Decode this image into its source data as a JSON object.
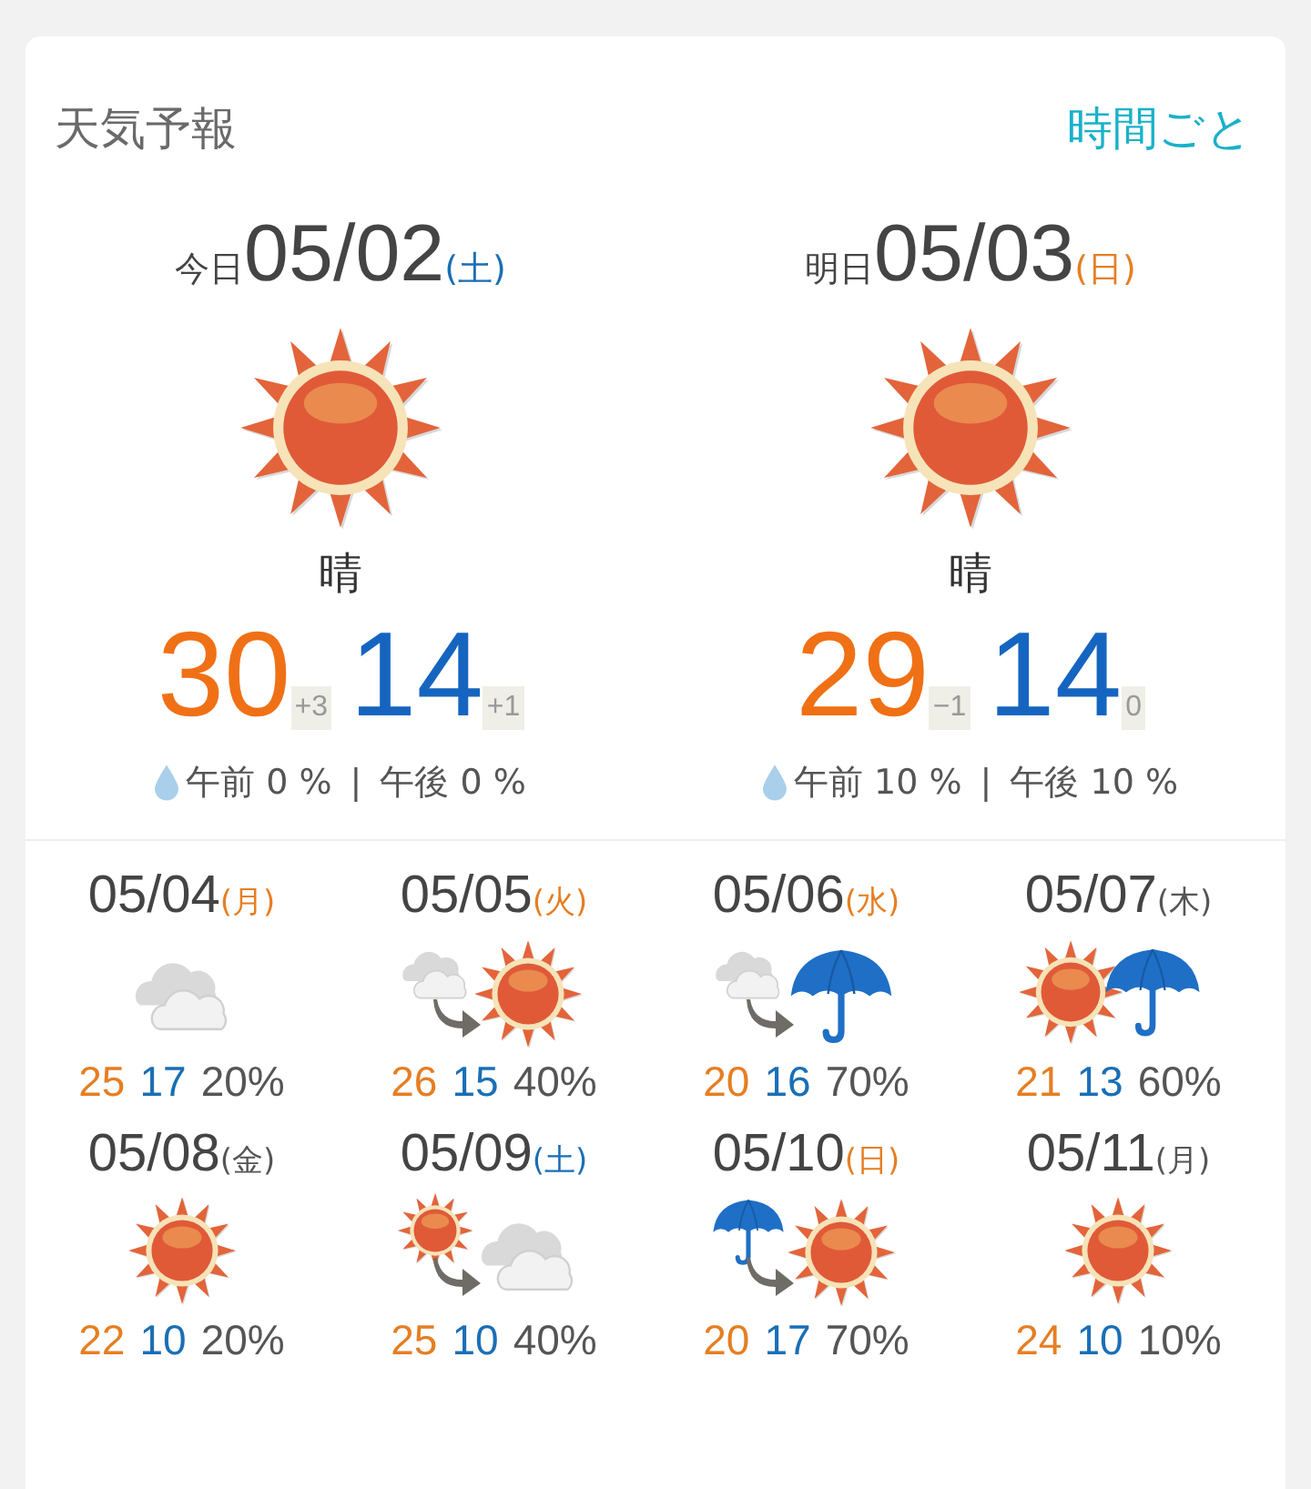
{
  "header": {
    "title": "天気予報",
    "link": "時間ごと"
  },
  "main_days": [
    {
      "label": "今日",
      "date": "05/02",
      "weekday": {
        "text": "(土)",
        "color": "#1a6fb5"
      },
      "icons": [
        {
          "kind": "sun"
        }
      ],
      "condition": "晴",
      "high": "30",
      "high_diff": "+3",
      "low": "14",
      "low_diff": "+1",
      "rain": [
        {
          "period": "午前",
          "value": "0 %"
        },
        {
          "period": "午後",
          "value": "0 %"
        }
      ],
      "separator": "|"
    },
    {
      "label": "明日",
      "date": "05/03",
      "weekday": {
        "text": "(日)",
        "color": "#e67e22"
      },
      "icons": [
        {
          "kind": "sun"
        }
      ],
      "condition": "晴",
      "high": "29",
      "high_diff": "−1",
      "low": "14",
      "low_diff": "0",
      "rain": [
        {
          "period": "午前",
          "value": "10 %"
        },
        {
          "period": "午後",
          "value": "10 %"
        }
      ],
      "separator": "|"
    }
  ],
  "forecast": [
    {
      "date": "05/04",
      "weekday": {
        "text": "(月)",
        "color": "#e67e22"
      },
      "icons": [
        {
          "kind": "cloud"
        }
      ],
      "arrow": false,
      "high": "25",
      "low": "17",
      "rain": "20%"
    },
    {
      "date": "05/05",
      "weekday": {
        "text": "(火)",
        "color": "#e67e22"
      },
      "icons": [
        {
          "kind": "cloud"
        },
        {
          "kind": "sun"
        }
      ],
      "arrow": true,
      "high": "26",
      "low": "15",
      "rain": "40%"
    },
    {
      "date": "05/06",
      "weekday": {
        "text": "(水)",
        "color": "#e67e22"
      },
      "icons": [
        {
          "kind": "cloud"
        },
        {
          "kind": "umbrella"
        }
      ],
      "arrow": true,
      "high": "20",
      "low": "16",
      "rain": "70%"
    },
    {
      "date": "05/07",
      "weekday": {
        "text": "(木)",
        "color": "#555555"
      },
      "icons": [
        {
          "kind": "sun"
        },
        {
          "kind": "umbrella"
        }
      ],
      "arrow": false,
      "high": "21",
      "low": "13",
      "rain": "60%"
    },
    {
      "date": "05/08",
      "weekday": {
        "text": "(金)",
        "color": "#555555"
      },
      "icons": [
        {
          "kind": "sun"
        }
      ],
      "arrow": false,
      "high": "22",
      "low": "10",
      "rain": "20%"
    },
    {
      "date": "05/09",
      "weekday": {
        "text": "(土)",
        "color": "#1a6fb5"
      },
      "icons": [
        {
          "kind": "sun"
        },
        {
          "kind": "cloud"
        }
      ],
      "arrow": true,
      "high": "25",
      "low": "10",
      "rain": "40%"
    },
    {
      "date": "05/10",
      "weekday": {
        "text": "(日)",
        "color": "#e67e22"
      },
      "icons": [
        {
          "kind": "umbrella"
        },
        {
          "kind": "sun"
        }
      ],
      "arrow": true,
      "high": "20",
      "low": "17",
      "rain": "70%"
    },
    {
      "date": "05/11",
      "weekday": {
        "text": "(月)",
        "color": "#555555"
      },
      "icons": [
        {
          "kind": "sun"
        }
      ],
      "arrow": false,
      "high": "24",
      "low": "10",
      "rain": "10%"
    }
  ]
}
